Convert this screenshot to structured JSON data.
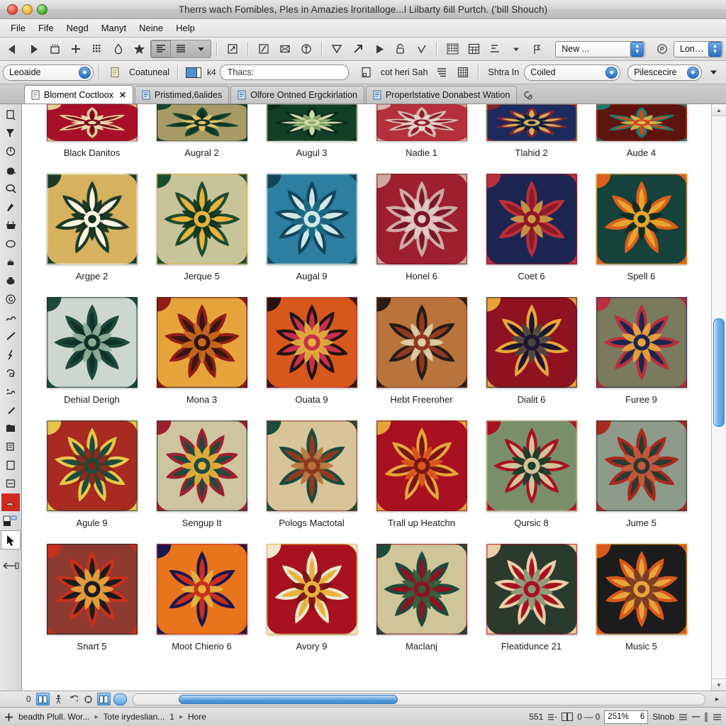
{
  "window": {
    "title": "Therrs wach Fomibles, Ples in Amazies lroritalloge...l Lilbarty 6ill Purtch. ('bill Shouch)",
    "buttons": [
      "close",
      "minimize",
      "zoom"
    ]
  },
  "menubar": {
    "items": [
      {
        "label": "File",
        "mnemonic": "F"
      },
      {
        "label": "Fife",
        "mnemonic": "F"
      },
      {
        "label": "Negd",
        "mnemonic": "N"
      },
      {
        "label": "Manyt",
        "mnemonic": "M"
      },
      {
        "label": "Neine",
        "mnemonic": "N"
      },
      {
        "label": "Help",
        "mnemonic": "H"
      }
    ]
  },
  "toolbar_top": {
    "icons": [
      "back-arrow-icon",
      "forward-arrow-icon",
      "new-window-icon",
      "add-plus-icon",
      "grid-dots-icon",
      "droplet-icon",
      "star-icon"
    ],
    "align_group": [
      "align-left-icon",
      "align-justify-icon",
      "chevron-down-icon"
    ],
    "icons2": [
      "export-icon",
      "pen-tablet-icon",
      "envelope-icon",
      "stamp-icon"
    ],
    "icons3": [
      "filter-triangle-icon",
      "arrow-up-right-icon",
      "play-triangle-icon",
      "unlock-icon",
      "checkmark-icon"
    ],
    "icons4": [
      "pixel-grid-icon",
      "spreadsheet-icon",
      "baseline-icon",
      "chevron-down-icon",
      "flag-icon"
    ],
    "new_combo": {
      "value": "New ...",
      "name": "new-dropdown"
    },
    "lonsides_combo": {
      "value": "Lonsides",
      "icon": "at-badge-icon",
      "name": "lonsides-dropdown"
    }
  },
  "toolbar_second": {
    "leoaide_combo": {
      "value": "Leoaide"
    },
    "coatuneal_label": "Coatuneal",
    "coatuneal_icon": "document-small-icon",
    "swatch_icon": "color-swatch-icon",
    "kx_label": "k4",
    "thacs_field": {
      "value": "Thacs:",
      "placeholder": "Thacs:"
    },
    "page_icon": "page-corner-icon",
    "cot_heri_sah_label": "cot heri Sah",
    "icons": [
      "lines-indent-icon",
      "table-grid-icon"
    ],
    "shtra_in_label": "Shtra In",
    "coiled_combo": {
      "value": "Coiled"
    },
    "pilescedre_combo": {
      "value": "Pilescecire"
    },
    "overflow_icon": "chevron-down-icon"
  },
  "tabs": [
    {
      "label": "Bloment Coctloox",
      "active": true,
      "closable": true,
      "icon": "document-tab-icon"
    },
    {
      "label": "Pristimed,6alides",
      "active": false,
      "closable": false,
      "icon": "document-tab-icon"
    },
    {
      "label": "Olfore Ontned Ergckirlation",
      "active": false,
      "closable": false,
      "icon": "document-tab-icon"
    },
    {
      "label": "Properlstative Donabest Wation",
      "active": false,
      "closable": false,
      "icon": "document-tab-icon"
    }
  ],
  "tabbar_extra_icon": "spiral-icon",
  "tool_strip": {
    "tools": [
      "artboard-icon",
      "direct-select-icon",
      "rotate-icon",
      "paint-bucket-icon",
      "magnifier-icon",
      "brush-icon",
      "basket-icon",
      "ellipse-icon",
      "hand-icon",
      "ink-pot-icon",
      "spiral-circle-icon",
      "scribble-icon",
      "line-segment-icon",
      "pen-anchor-icon",
      "crop-icon",
      "mesh-icon",
      "flame-icon",
      "pencil-icon",
      "folder-stack-icon",
      "print-icon",
      "page-icon",
      "symbols-icon"
    ],
    "swatch_red": "red-swatch",
    "swatch_bw": "black-white-swatch",
    "selection_tool": "selection-arrow-icon",
    "back_button": "back-to-previous-icon"
  },
  "grid": {
    "rows": [
      {
        "clipped": true,
        "cells": [
          {
            "label": "Black Danitos",
            "pattern": "p1"
          },
          {
            "label": "Augral 2",
            "pattern": "p2"
          },
          {
            "label": "Augul 3",
            "pattern": "p3"
          },
          {
            "label": "Nadie 1",
            "pattern": "p4"
          },
          {
            "label": "Tlahid 2",
            "pattern": "p5"
          },
          {
            "label": "Aude 4",
            "pattern": "p6"
          }
        ]
      },
      {
        "clipped": false,
        "cells": [
          {
            "label": "Argpe 2",
            "pattern": "p7"
          },
          {
            "label": "Jerque 5",
            "pattern": "p8"
          },
          {
            "label": "Augal 9",
            "pattern": "p9"
          },
          {
            "label": "Honel 6",
            "pattern": "p10"
          },
          {
            "label": "Coet 6",
            "pattern": "p11"
          },
          {
            "label": "Spell 6",
            "pattern": "p12"
          }
        ]
      },
      {
        "clipped": false,
        "cells": [
          {
            "label": "Dehial Derigh",
            "pattern": "p13"
          },
          {
            "label": "Mona 3",
            "pattern": "p14"
          },
          {
            "label": "Ouata 9",
            "pattern": "p15"
          },
          {
            "label": "Hebt Freeroher",
            "pattern": "p16"
          },
          {
            "label": "Dialit 6",
            "pattern": "p17"
          },
          {
            "label": "Furee 9",
            "pattern": "p18"
          }
        ]
      },
      {
        "clipped": false,
        "cells": [
          {
            "label": "Agule 9",
            "pattern": "p19"
          },
          {
            "label": "Sengup It",
            "pattern": "p20"
          },
          {
            "label": "Pologs Mactotal",
            "pattern": "p21"
          },
          {
            "label": "Trall up Heatchn",
            "pattern": "p22"
          },
          {
            "label": "Qursic 8",
            "pattern": "p23"
          },
          {
            "label": "Jume 5",
            "pattern": "p24"
          }
        ]
      },
      {
        "clipped": false,
        "cells": [
          {
            "label": "Snart 5",
            "pattern": "p25"
          },
          {
            "label": "Moot Chierio 6",
            "pattern": "p26"
          },
          {
            "label": "Avory 9",
            "pattern": "p27"
          },
          {
            "label": "Maclanj",
            "pattern": "p28"
          },
          {
            "label": "Fleatidunce 21",
            "pattern": "p29"
          },
          {
            "label": "Music 5",
            "pattern": "p30"
          }
        ]
      }
    ]
  },
  "hscrollbar": {
    "left_label": "0",
    "icons": [
      "page-view-icon",
      "person-icon",
      "undo-icon",
      "refresh-icon",
      "columns-icon"
    ]
  },
  "statusbar": {
    "add_icon": "plus-icon",
    "crumb1": "beadth Plull. Wor...",
    "crumb2": "Tote irydeslian...",
    "crumb3": "1",
    "crumb4": "Hore",
    "page_count": "551",
    "layout_icon": "layout-icon",
    "book_icon": "book-icon",
    "view_val": "0 — 0",
    "zoom_value": "251%",
    "zoom_stepper": "6",
    "slnob_label": "Slnob",
    "right_icons": [
      "list-icon",
      "minus-icon",
      "bar-icon",
      "menu-icon"
    ]
  },
  "colors": {
    "accent": "#4e97de",
    "titlebar": "#d2d2d2",
    "toolbar": "#e4e4e4",
    "canvas": "#ffffff"
  }
}
